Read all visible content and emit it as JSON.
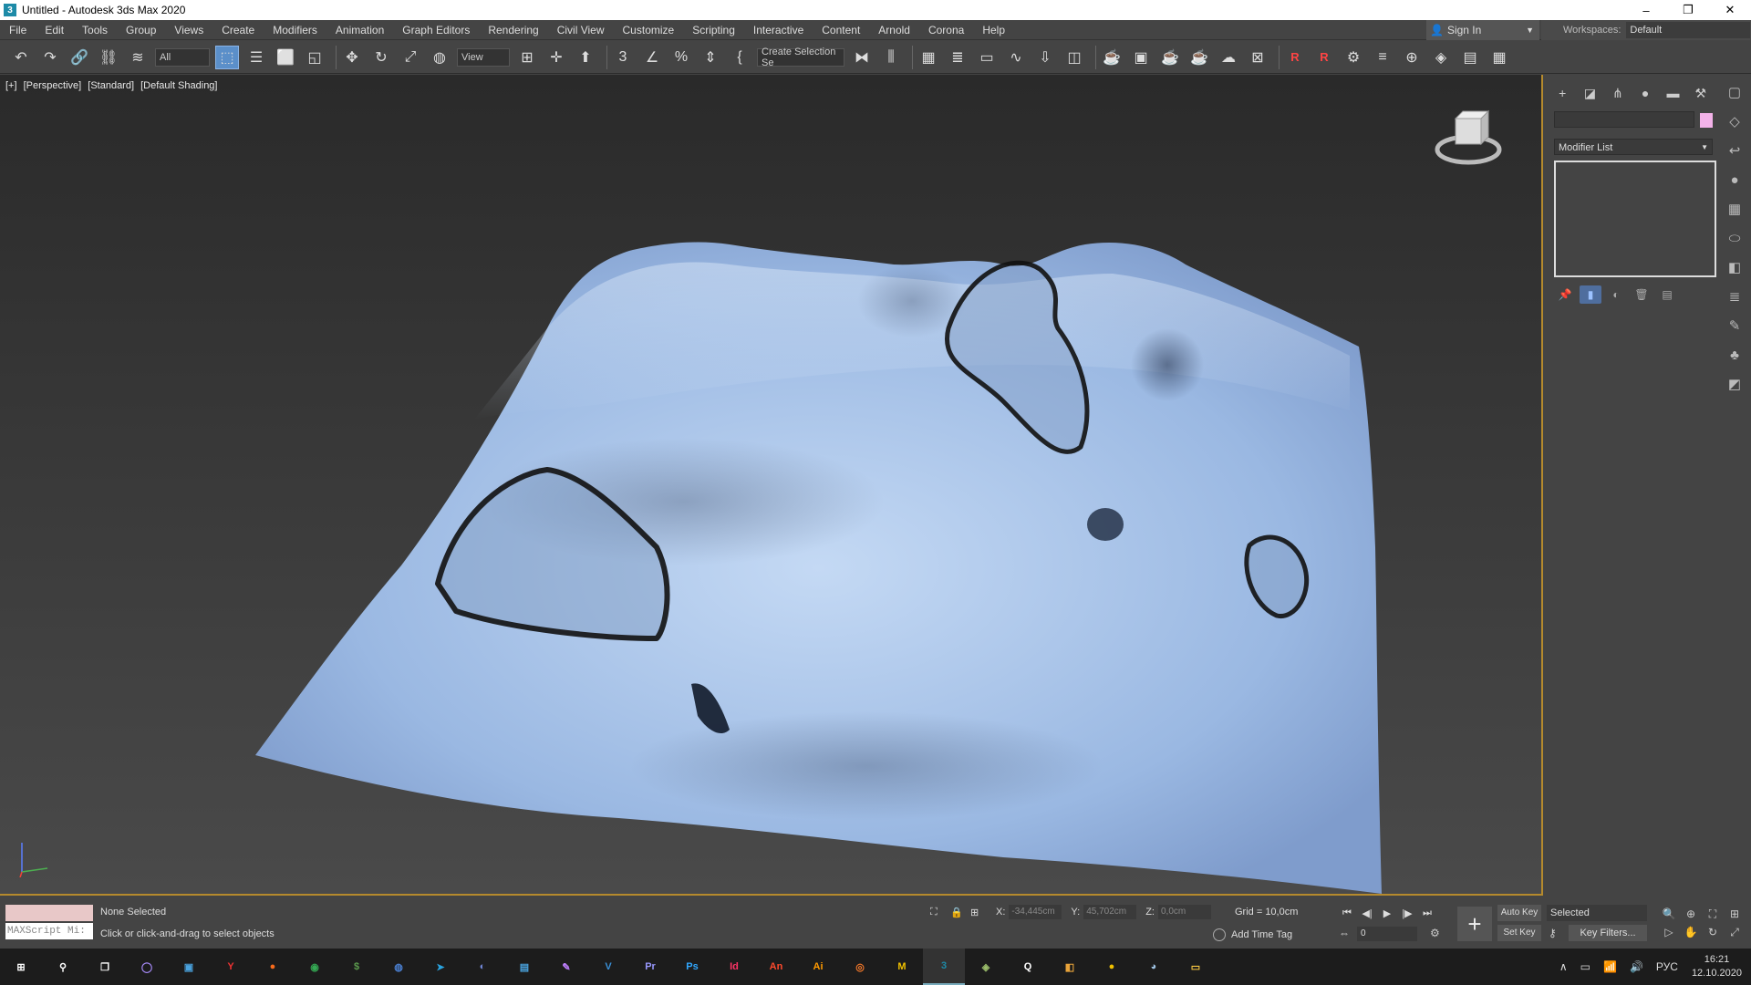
{
  "window": {
    "title": "Untitled - Autodesk 3ds Max 2020",
    "controls": [
      "–",
      "❐",
      "✕"
    ]
  },
  "menu": [
    "File",
    "Edit",
    "Tools",
    "Group",
    "Views",
    "Create",
    "Modifiers",
    "Animation",
    "Graph Editors",
    "Rendering",
    "Civil View",
    "Customize",
    "Scripting",
    "Interactive",
    "Content",
    "Arnold",
    "Corona",
    "Help"
  ],
  "header": {
    "sign_in": "Sign In",
    "workspaces_label": "Workspaces:",
    "workspace_value": "Default"
  },
  "toolbar": {
    "selection_filter": "All",
    "ref_coord": "View",
    "named_selection": "Create Selection Se"
  },
  "viewport": {
    "labels": [
      "[+]",
      "[Perspective]",
      "[Standard]",
      "[Default Shading]"
    ],
    "object_color": "#9ab8e2"
  },
  "command_panel": {
    "modifier_list": "Modifier List",
    "object_color": "#f3b2e9"
  },
  "status": {
    "maxscript_placeholder": "MAXScript Mi:",
    "selection": "None Selected",
    "prompt": "Click or click-and-drag to select objects",
    "x_label": "X:",
    "x_value": "-34,445cm",
    "y_label": "Y:",
    "y_value": "45,702cm",
    "z_label": "Z:",
    "z_value": "0,0cm",
    "grid": "Grid = 10,0cm",
    "add_time_tag": "Add Time Tag",
    "frame": "0",
    "auto_key": "Auto Key",
    "set_key": "Set Key",
    "key_mode": "Selected",
    "key_filters": "Key Filters..."
  },
  "taskbar": {
    "apps": [
      {
        "name": "windows-start",
        "glyph": "⊞",
        "color": "#fff"
      },
      {
        "name": "search",
        "glyph": "⚲",
        "color": "#fff"
      },
      {
        "name": "task-view",
        "glyph": "❐",
        "color": "#fff"
      },
      {
        "name": "cortana",
        "glyph": "◯",
        "color": "#a78bfa"
      },
      {
        "name": "3d-viewer",
        "glyph": "▣",
        "color": "#4aa3df"
      },
      {
        "name": "yandex",
        "glyph": "Y",
        "color": "#e33"
      },
      {
        "name": "firefox",
        "glyph": "●",
        "color": "#f76b1c"
      },
      {
        "name": "chrome",
        "glyph": "◉",
        "color": "#34a853"
      },
      {
        "name": "money",
        "glyph": "$",
        "color": "#5c9c4e"
      },
      {
        "name": "opera",
        "glyph": "◍",
        "color": "#4a7fd0"
      },
      {
        "name": "telegram",
        "glyph": "➤",
        "color": "#2aa3df"
      },
      {
        "name": "discord",
        "glyph": "◐",
        "color": "#7289da"
      },
      {
        "name": "notepad",
        "glyph": "▤",
        "color": "#4aa3df"
      },
      {
        "name": "paint",
        "glyph": "✎",
        "color": "#c080ff"
      },
      {
        "name": "visual-studio",
        "glyph": "V",
        "color": "#3a8fd6"
      },
      {
        "name": "premiere",
        "glyph": "Pr",
        "color": "#9999ff"
      },
      {
        "name": "photoshop",
        "glyph": "Ps",
        "color": "#31a8ff"
      },
      {
        "name": "indesign",
        "glyph": "Id",
        "color": "#ff3366"
      },
      {
        "name": "animate",
        "glyph": "An",
        "color": "#ff4a2d"
      },
      {
        "name": "illustrator",
        "glyph": "Ai",
        "color": "#ff9a00"
      },
      {
        "name": "blender",
        "glyph": "◎",
        "color": "#f5792a"
      },
      {
        "name": "maya",
        "glyph": "M",
        "color": "#f0c000"
      },
      {
        "name": "3ds-max",
        "glyph": "3",
        "color": "#1d8aa7"
      },
      {
        "name": "zbrush",
        "glyph": "◈",
        "color": "#9abc6a"
      },
      {
        "name": "search2",
        "glyph": "Q",
        "color": "#fff"
      },
      {
        "name": "substance",
        "glyph": "◧",
        "color": "#e8a33a"
      },
      {
        "name": "marmoset",
        "glyph": "●",
        "color": "#f0c000"
      },
      {
        "name": "steam",
        "glyph": "◕",
        "color": "#9fc3e3"
      },
      {
        "name": "explorer",
        "glyph": "▭",
        "color": "#f5c542"
      }
    ],
    "tray": {
      "lang": "РУС",
      "time": "16:21",
      "date": "12.10.2020"
    }
  }
}
